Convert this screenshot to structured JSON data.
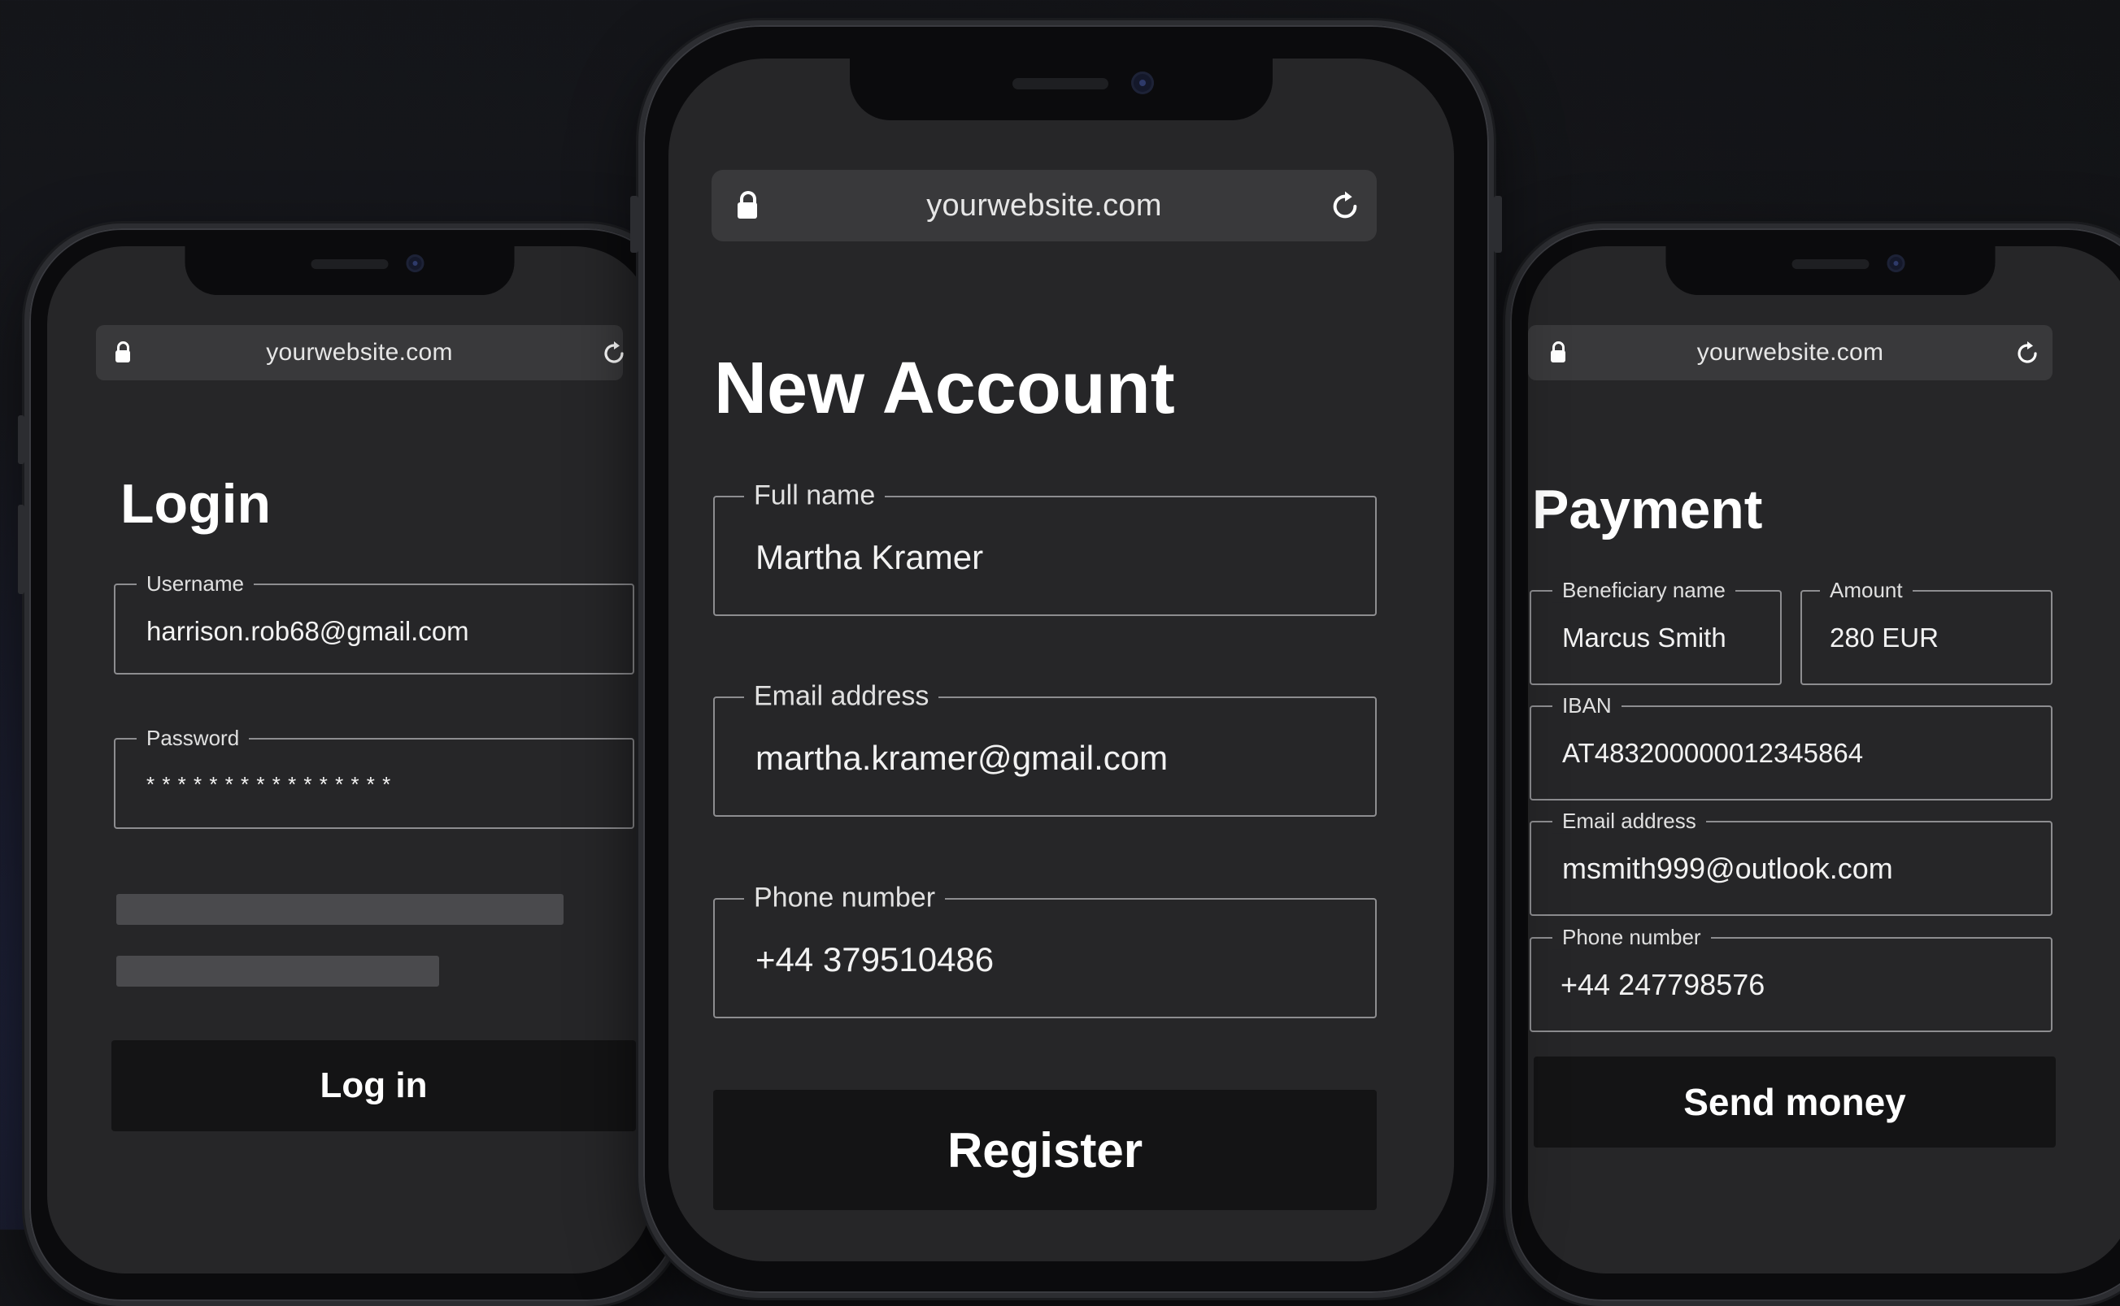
{
  "left": {
    "url": "yourwebsite.com",
    "title": "Login",
    "username_label": "Username",
    "username_value": "harrison.rob68@gmail.com",
    "password_label": "Password",
    "password_value": "* * * * * * * * * * * * * * * *",
    "button_label": "Log in"
  },
  "center": {
    "url": "yourwebsite.com",
    "title": "New Account",
    "fullname_label": "Full name",
    "fullname_value": "Martha Kramer",
    "email_label": "Email address",
    "email_value": "martha.kramer@gmail.com",
    "phone_label": "Phone number",
    "phone_value": "+44 379510486",
    "button_label": "Register"
  },
  "right": {
    "url": "yourwebsite.com",
    "title": "Payment",
    "beneficiary_label": "Beneficiary name",
    "beneficiary_value": "Marcus Smith",
    "amount_label": "Amount",
    "amount_value": "280 EUR",
    "iban_label": "IBAN",
    "iban_value": "AT483200000012345864",
    "email_label": "Email address",
    "email_value": "msmith999@outlook.com",
    "phone_label": "Phone number",
    "phone_value": "+44 247798576",
    "button_label": "Send money"
  },
  "icons": {
    "lock": "lock-icon",
    "reload": "reload-icon"
  },
  "colors": {
    "screen_bg": "#262628",
    "button_bg": "#141415",
    "field_border": "#8d8d90",
    "urlbar_bg": "#39393b"
  }
}
